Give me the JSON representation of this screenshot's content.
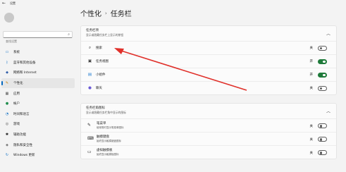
{
  "window": {
    "title": "设置"
  },
  "sidebar": {
    "search_placeholder": "查找设置",
    "items": [
      {
        "label": "系统",
        "icon": "monitor-icon",
        "color": "#0067c0"
      },
      {
        "label": "蓝牙和其他设备",
        "icon": "bluetooth-icon",
        "color": "#0067c0"
      },
      {
        "label": "网络和 Internet",
        "icon": "network-icon",
        "color": "#2d5ba8"
      },
      {
        "label": "个性化",
        "icon": "brush-icon",
        "color": "#c07a00",
        "active": true
      },
      {
        "label": "应用",
        "icon": "apps-icon",
        "color": "#444444"
      },
      {
        "label": "帐户",
        "icon": "person-icon",
        "color": "#1e8c4c"
      },
      {
        "label": "时间和语言",
        "icon": "globe-clock-icon",
        "color": "#0067c0"
      },
      {
        "label": "游戏",
        "icon": "gamepad-icon",
        "color": "#555555"
      },
      {
        "label": "辅助功能",
        "icon": "accessibility-icon",
        "color": "#1b1b1b"
      },
      {
        "label": "隐私和安全性",
        "icon": "shield-icon",
        "color": "#555555"
      },
      {
        "label": "Windows 更新",
        "icon": "update-icon",
        "color": "#0067c0"
      }
    ]
  },
  "breadcrumb": {
    "parent": "个性化",
    "separator": "›",
    "current": "任务栏"
  },
  "taskbar_items": {
    "title": "任务栏项",
    "subtitle": "显示或隐藏任务栏上显示的按钮",
    "rows": [
      {
        "label": "搜索",
        "icon": "search-icon",
        "state": "关",
        "on": false
      },
      {
        "label": "任务视图",
        "icon": "task-view-icon",
        "state": "开",
        "on": true
      },
      {
        "label": "小组件",
        "icon": "widgets-icon",
        "state": "开",
        "on": true
      },
      {
        "label": "聊天",
        "icon": "chat-icon",
        "state": "关",
        "on": false
      }
    ]
  },
  "corner_icons": {
    "title": "任务栏角图标",
    "subtitle": "显示或隐藏任务栏角中显示的图标",
    "rows": [
      {
        "label": "笔菜单",
        "desc": "使用笔时显示笔菜单图标",
        "icon": "pen-icon",
        "state": "关",
        "on": false
      },
      {
        "label": "触摸键盘",
        "desc": "始终显示触摸键盘图标",
        "icon": "keyboard-icon",
        "state": "关",
        "on": false
      },
      {
        "label": "虚拟触摸板",
        "desc": "始终显示触摸板图标",
        "icon": "touchpad-icon",
        "state": "关",
        "on": false
      }
    ]
  },
  "annotation": {
    "color": "#e0302a"
  }
}
